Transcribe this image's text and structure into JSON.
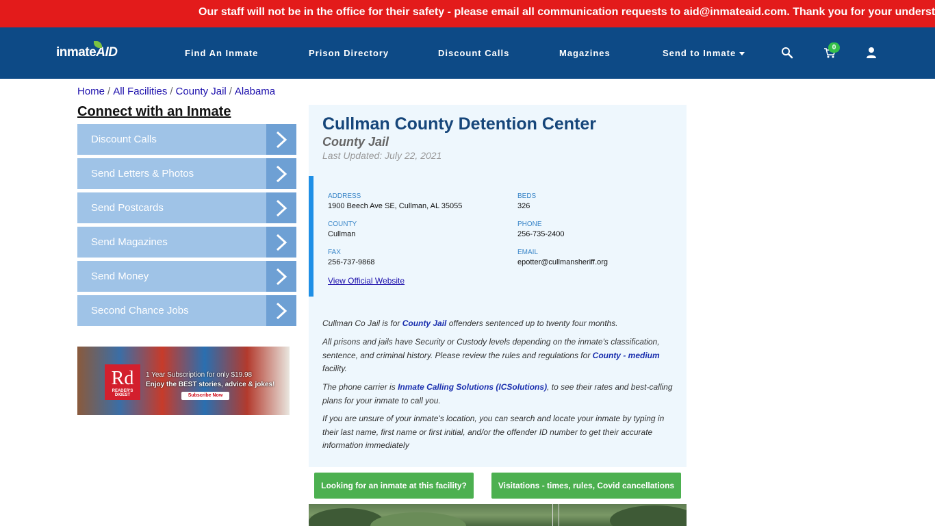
{
  "alert": {
    "text": "Our staff will not be in the office for their safety - please email all communication requests to aid@inmateaid.com. Thank you for your understanding."
  },
  "nav": {
    "logo_main": "inmate",
    "logo_accent": "AID",
    "links": [
      "Find An Inmate",
      "Prison Directory",
      "Discount Calls",
      "Magazines",
      "Send to Inmate"
    ],
    "cart_count": "0",
    "icons": [
      "search-icon",
      "cart-icon",
      "user-icon"
    ]
  },
  "breadcrumb": [
    "Home",
    "All Facilities",
    "County Jail",
    "Alabama"
  ],
  "sidebar": {
    "title": "Connect with an Inmate",
    "items": [
      "Discount Calls",
      "Send Letters & Photos",
      "Send Postcards",
      "Send Magazines",
      "Send Money",
      "Second Chance Jobs"
    ]
  },
  "ad": {
    "logo": "Rd",
    "logo_sub": "READER'S DIGEST",
    "line1": "1 Year Subscription for only $19.98",
    "line2": "Enjoy the BEST stories, advice & jokes!",
    "button": "Subscribe Now"
  },
  "facility": {
    "name": "Cullman County Detention Center",
    "type": "County Jail",
    "updated": "Last Updated: July 22, 2021",
    "address_label": "ADDRESS",
    "address": "1900 Beech Ave SE, Cullman, AL 35055",
    "beds_label": "BEDS",
    "beds": "326",
    "county_label": "COUNTY",
    "county": "Cullman",
    "phone_label": "PHONE",
    "phone": "256-735-2400",
    "fax_label": "FAX",
    "fax": "256-737-9868",
    "email_label": "EMAIL",
    "email": "epotter@cullmansheriff.org",
    "website_link": "View Official Website"
  },
  "description": {
    "p1_a": "Cullman Co Jail is for ",
    "p1_link": "County Jail",
    "p1_b": " offenders sentenced up to twenty four months.",
    "p2_a": "All prisons and jails have Security or Custody levels depending on the inmate's classification, sentence, and criminal history. Please review the rules and regulations for ",
    "p2_link": "County - medium",
    "p2_b": " facility.",
    "p3_a": "The phone carrier is ",
    "p3_link": "Inmate Calling Solutions (ICSolutions)",
    "p3_b": ", to see their rates and best-calling plans for your inmate to call you.",
    "p4": "If you are unsure of your inmate's location, you can search and locate your inmate by typing in their last name, first name or first initial, and/or the offender ID number to get their accurate information immediately"
  },
  "actions": {
    "find_inmate": "Looking for an inmate at this facility?",
    "visitations": "Visitations - times, rules, Covid cancellations"
  }
}
